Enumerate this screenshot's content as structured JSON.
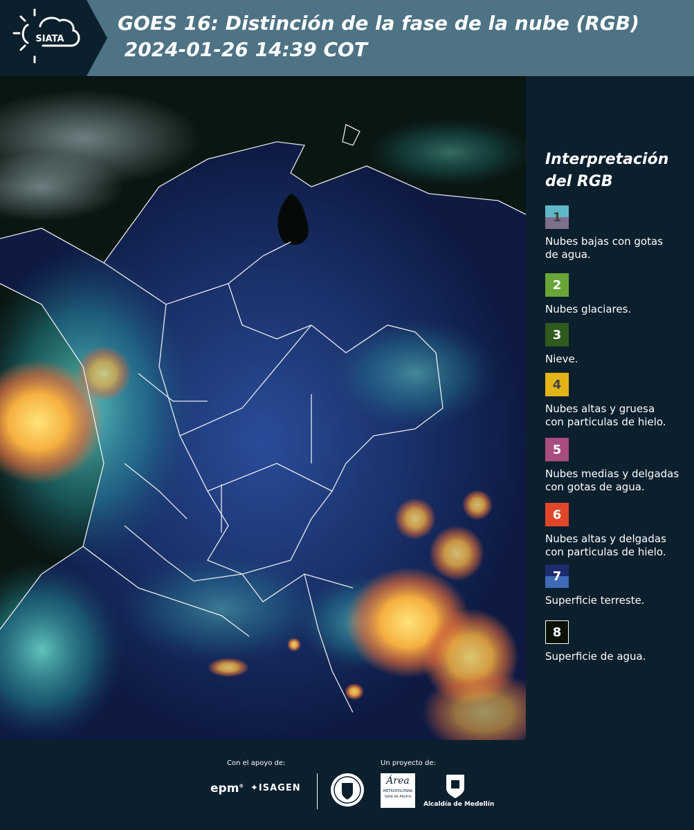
{
  "header": {
    "title_line1": "GOES 16: Distinción de la fase de la nube (RGB)",
    "title_line2": " 2024-01-26 14:39 COT",
    "logo": "SIATA"
  },
  "legend": {
    "title_line1": "Interpretación",
    "title_line2": "del RGB",
    "items": [
      {
        "number": "1",
        "label_line1": "Nubes bajas con gotas",
        "label_line2": "de agua.",
        "top_color": "#5fb8c9",
        "bottom_color": "#7d6e8c",
        "text_color": "#444444"
      },
      {
        "number": "2",
        "label_line1": "Nubes glaciares.",
        "label_line2": "",
        "top_color": "#6aa537",
        "bottom_color": "#6aa537",
        "text_color": "#ffffff"
      },
      {
        "number": "3",
        "label_line1": "Nieve.",
        "label_line2": "",
        "top_color": "#2e5a1c",
        "bottom_color": "#2e5a1c",
        "text_color": "#ffffff"
      },
      {
        "number": "4",
        "label_line1": "Nubes altas y gruesa",
        "label_line2": "con particulas de hielo.",
        "top_color": "#e3b418",
        "bottom_color": "#e3b418",
        "text_color": "#444444"
      },
      {
        "number": "5",
        "label_line1": "Nubes medias y delgadas",
        "label_line2": "con gotas de agua.",
        "top_color": "#a94c7e",
        "bottom_color": "#a94c7e",
        "text_color": "#ffffff"
      },
      {
        "number": "6",
        "label_line1": "Nubes altas y delgadas",
        "label_line2": "con particulas de hielo.",
        "top_color": "#e0462a",
        "bottom_color": "#e0462a",
        "text_color": "#ffffff"
      },
      {
        "number": "7",
        "label_line1": "Superficie terreste.",
        "label_line2": "",
        "top_color": "#1d2b6e",
        "bottom_color": "#3f6ab8",
        "text_color": "#ffffff"
      },
      {
        "number": "8",
        "label_line1": "Superficie de agua.",
        "label_line2": "",
        "top_color": "#0a1208",
        "bottom_color": "#0a1208",
        "text_color": "#ffffff"
      }
    ]
  },
  "footer": {
    "support_label": "Con el apoyo de:",
    "project_label": "Un proyecto de:",
    "epm": "epm",
    "isagen": "ISAGEN",
    "area_line1": "Área",
    "area_line2": "METROPOLITANA",
    "area_line3": "Valle de Aburrá",
    "medellin": "Alcaldía de Medellín"
  }
}
